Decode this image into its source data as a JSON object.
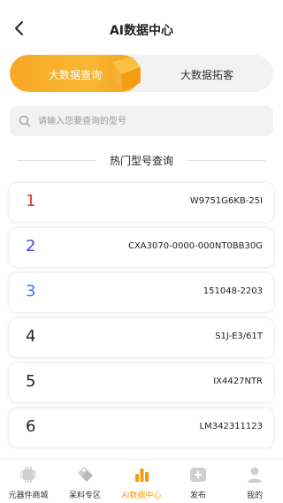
{
  "header": {
    "title": "AI数据中心"
  },
  "tabs": [
    {
      "label": "大数据查询",
      "active": true
    },
    {
      "label": "大数据拓客",
      "active": false
    }
  ],
  "search": {
    "placeholder": "请输入您要查询的型号",
    "value": ""
  },
  "section": {
    "title": "热门型号查询"
  },
  "hot_models": [
    {
      "rank": "1",
      "model": "W9751G6KB-25I",
      "color": "#e8353a"
    },
    {
      "rank": "2",
      "model": "CXA3070-0000-000NT0BB30G",
      "color": "#3a4fd6"
    },
    {
      "rank": "3",
      "model": "151048-2203",
      "color": "#3a79e6"
    },
    {
      "rank": "4",
      "model": "S1J-E3/61T",
      "color": "#222222"
    },
    {
      "rank": "5",
      "model": "IX4427NTR",
      "color": "#222222"
    },
    {
      "rank": "6",
      "model": "LM342311123",
      "color": "#222222"
    }
  ],
  "tabbar": [
    {
      "label": "元器件商城",
      "icon": "chip-icon",
      "active": false
    },
    {
      "label": "呆料专区",
      "icon": "tags-icon",
      "active": false
    },
    {
      "label": "AI数据中心",
      "icon": "bar-chart-icon",
      "active": true
    },
    {
      "label": "发布",
      "icon": "plus-icon",
      "active": false
    },
    {
      "label": "我的",
      "icon": "user-icon",
      "active": false
    }
  ],
  "colors": {
    "accent": "#f59a12",
    "tab_gradient_start": "#f9a825",
    "tab_gradient_end": "#f5a21d"
  }
}
